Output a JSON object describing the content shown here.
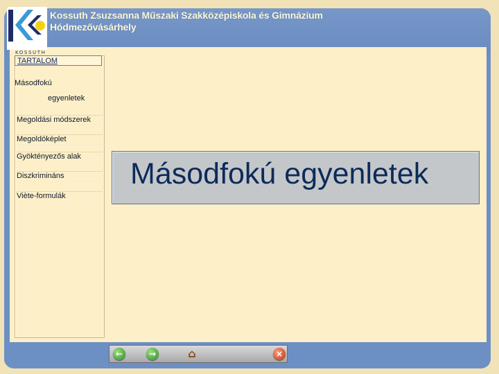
{
  "header": {
    "school_line1": "Kossuth Zsuzsanna Műszaki Szakközépiskola és Gimnázium",
    "school_line2": "Hódmezővásárhely",
    "logo_caption": "KOSSUTH"
  },
  "sidebar": {
    "title": "TARTALOM",
    "items": [
      {
        "label": "Másodfokú"
      },
      {
        "label": "egyenletek"
      },
      {
        "label": "Megoldási módszerek"
      },
      {
        "label": "Megoldóképlet"
      },
      {
        "label": "Gyöktényezős alak"
      },
      {
        "label": "Diszkrimináns"
      },
      {
        "label": "Viète-formulák"
      }
    ]
  },
  "main": {
    "title": "Másodfokú egyenletek"
  },
  "nav": {
    "back_icon": "arrow-left-icon",
    "forward_icon": "arrow-right-icon",
    "home_icon": "home-icon",
    "close_icon": "close-icon"
  },
  "colors": {
    "frame": "#6d90c4",
    "content": "#fdf0c9",
    "title_box": "#c4c7c9",
    "title_text": "#0d2b5a"
  }
}
